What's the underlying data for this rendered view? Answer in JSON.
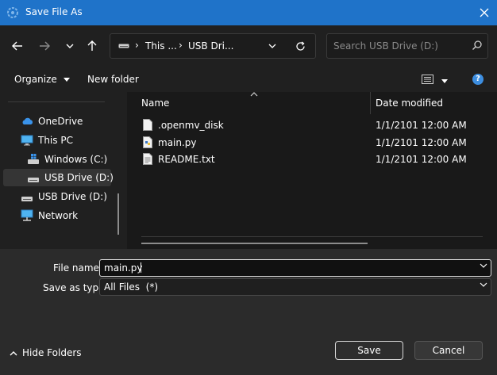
{
  "window": {
    "title": "Save File As",
    "accent": "#1f73c9"
  },
  "nav": {
    "back_icon": "arrow-left-icon",
    "forward_icon": "arrow-right-icon",
    "recent_icon": "chevron-down-icon",
    "up_icon": "arrow-up-icon"
  },
  "address": {
    "crumbs": [
      "This ...",
      "USB Dri..."
    ],
    "sep": "›",
    "refresh_icon": "refresh-icon"
  },
  "search": {
    "placeholder": "Search USB Drive (D:)"
  },
  "toolbar": {
    "organize_label": "Organize",
    "new_folder_label": "New folder",
    "help_label": "?"
  },
  "sidebar": {
    "items": [
      {
        "label": "OneDrive",
        "icon": "cloud-icon"
      },
      {
        "label": "This PC",
        "icon": "monitor-icon"
      },
      {
        "label": "Windows (C:)",
        "icon": "windows-drive-icon"
      },
      {
        "label": "USB Drive (D:)",
        "icon": "usb-drive-icon",
        "selected": true
      },
      {
        "label": "USB Drive (D:)",
        "icon": "usb-drive-icon"
      },
      {
        "label": "Network",
        "icon": "network-icon"
      }
    ]
  },
  "files": {
    "columns": [
      "Name",
      "Date modified"
    ],
    "rows": [
      {
        "name": ".openmv_disk",
        "date": "1/1/2101 12:00 AM",
        "icon": "blank-file-icon"
      },
      {
        "name": "main.py",
        "date": "1/1/2101 12:00 AM",
        "icon": "python-file-icon"
      },
      {
        "name": "README.txt",
        "date": "1/1/2101 12:00 AM",
        "icon": "text-file-icon"
      }
    ]
  },
  "form": {
    "file_name_label": "File name:",
    "file_name_value": "main.py",
    "save_type_label": "Save as type:",
    "save_type_value": "All Files  (*)"
  },
  "footer": {
    "hide_folders_label": "Hide Folders",
    "save_label": "Save",
    "cancel_label": "Cancel"
  }
}
